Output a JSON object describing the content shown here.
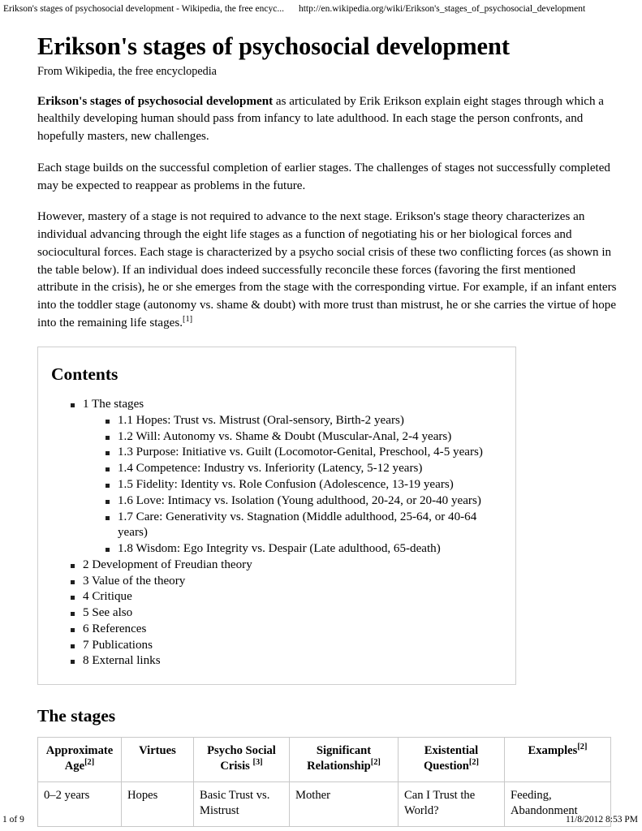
{
  "print_header": {
    "document_title": "Erikson's stages of psychosocial development - Wikipedia, the free encyc...",
    "url": "http://en.wikipedia.org/wiki/Erikson's_stages_of_psychosocial_development"
  },
  "article": {
    "title": "Erikson's stages of psychosocial development",
    "tagline": "From Wikipedia, the free encyclopedia",
    "lead_bold": "Erikson's stages of psychosocial development",
    "paragraph_1_rest": " as articulated by Erik Erikson explain eight stages through which a healthily developing human should pass from infancy to late adulthood. In each stage the person confronts, and hopefully masters, new challenges.",
    "paragraph_2": "Each stage builds on the successful completion of earlier stages. The challenges of stages not successfully completed may be expected to reappear as problems in the future.",
    "paragraph_3": "However, mastery of a stage is not required to advance to the next stage. Erikson's stage theory characterizes an individual advancing through the eight life stages as a function of negotiating his or her biological forces and sociocultural forces. Each stage is characterized by a psycho social crisis of these two conflicting forces (as shown in the table below). If an individual does indeed successfully reconcile these forces (favoring the first mentioned attribute in the crisis), he or she emerges from the stage with the corresponding virtue. For example, if an infant enters into the toddler stage (autonomy vs. shame & doubt) with more trust than mistrust, he or she carries the virtue of hope into the remaining life stages.",
    "paragraph_3_ref": "[1]"
  },
  "contents": {
    "heading": "Contents",
    "items": [
      {
        "label": "1 The stages",
        "children": [
          "1.1 Hopes: Trust vs. Mistrust (Oral-sensory, Birth-2 years)",
          "1.2 Will: Autonomy vs. Shame & Doubt (Muscular-Anal, 2-4 years)",
          "1.3 Purpose: Initiative vs. Guilt (Locomotor-Genital, Preschool, 4-5 years)",
          "1.4 Competence: Industry vs. Inferiority (Latency, 5-12 years)",
          "1.5 Fidelity: Identity vs. Role Confusion (Adolescence, 13-19 years)",
          "1.6 Love: Intimacy vs. Isolation (Young adulthood, 20-24, or 20-40 years)",
          "1.7 Care: Generativity vs. Stagnation (Middle adulthood, 25-64, or 40-64 years)",
          "1.8 Wisdom: Ego Integrity vs. Despair (Late adulthood, 65-death)"
        ]
      },
      {
        "label": "2 Development of Freudian theory",
        "children": []
      },
      {
        "label": "3 Value of the theory",
        "children": []
      },
      {
        "label": "4 Critique",
        "children": []
      },
      {
        "label": "5 See also",
        "children": []
      },
      {
        "label": "6 References",
        "children": []
      },
      {
        "label": "7 Publications",
        "children": []
      },
      {
        "label": "8 External links",
        "children": []
      }
    ]
  },
  "stages_section": {
    "heading": "The stages",
    "table": {
      "headers": [
        {
          "text": "Approximate Age",
          "ref": "[2]"
        },
        {
          "text": "Virtues",
          "ref": ""
        },
        {
          "text": "Psycho Social Crisis ",
          "ref": "[3]"
        },
        {
          "text": "Significant Relationship",
          "ref": "[2]"
        },
        {
          "text": "Existential Question",
          "ref": "[2]"
        },
        {
          "text": "Examples",
          "ref": "[2]"
        }
      ],
      "rows": [
        {
          "age": "0–2 years",
          "virtues": "Hopes",
          "crisis": "Basic Trust vs. Mistrust",
          "relationship": "Mother",
          "question": "Can I Trust the World?",
          "examples": "Feeding, Abandonment"
        }
      ]
    }
  },
  "print_footer": {
    "page": "1 of 9",
    "timestamp": "11/8/2012 8:53 PM"
  }
}
